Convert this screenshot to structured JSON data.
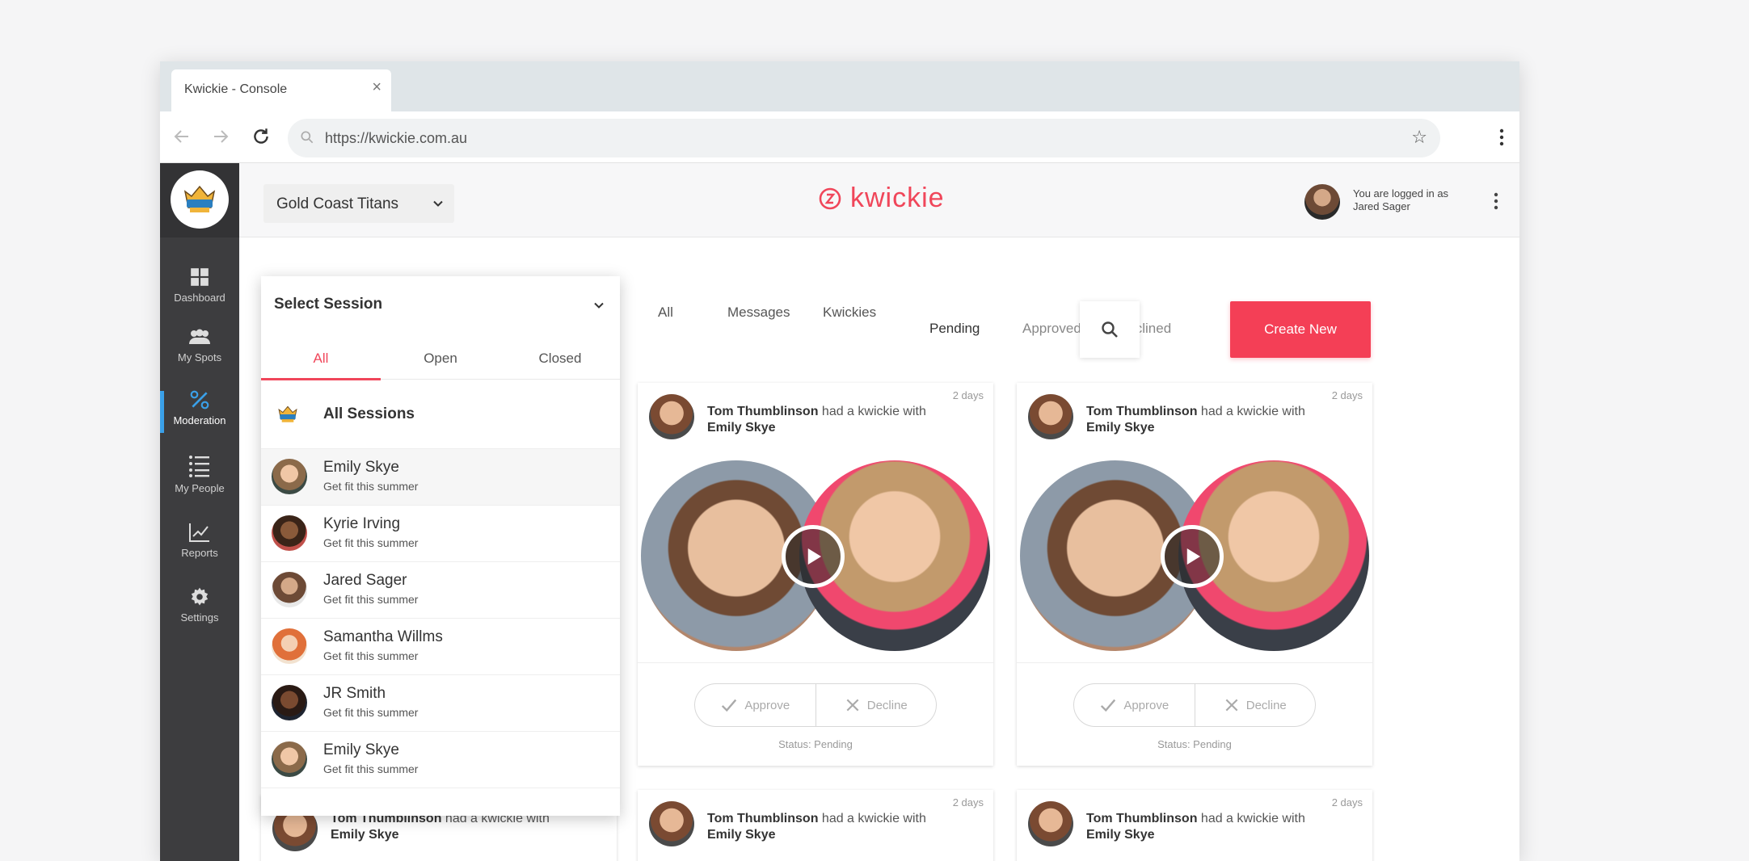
{
  "browser": {
    "tab_title": "Kwickie - Console",
    "url": "https://kwickie.com.au"
  },
  "sidebar": {
    "items": [
      {
        "label": "Dashboard",
        "icon": "grid-icon"
      },
      {
        "label": "My Spots",
        "icon": "people-icon"
      },
      {
        "label": "Moderation",
        "icon": "percent-icon",
        "active": true
      },
      {
        "label": "My People",
        "icon": "list-icon"
      },
      {
        "label": "Reports",
        "icon": "chart-icon"
      },
      {
        "label": "Settings",
        "icon": "gear-icon"
      }
    ]
  },
  "header": {
    "org_name": "Gold Coast Titans",
    "brand": "kwickie",
    "user_line1": "You are logged in as",
    "user_line2": "Jared Sager"
  },
  "filters": {
    "type_tabs": [
      "All",
      "Messages",
      "Kwickies"
    ],
    "status_tabs": [
      "Pending",
      "Approved",
      "Declined"
    ],
    "create_label": "Create New"
  },
  "session_panel": {
    "title": "Select Session",
    "tabs": [
      "All",
      "Open",
      "Closed"
    ],
    "all_label": "All Sessions",
    "sessions": [
      {
        "name": "Emily Skye",
        "sub": "Get fit this summer"
      },
      {
        "name": "Kyrie Irving",
        "sub": "Get fit this summer"
      },
      {
        "name": "Jared Sager",
        "sub": "Get fit this summer"
      },
      {
        "name": "Samantha Willms",
        "sub": "Get fit this summer"
      },
      {
        "name": "JR Smith",
        "sub": "Get fit this summer"
      },
      {
        "name": "Emily Skye",
        "sub": "Get fit this summer"
      }
    ]
  },
  "card": {
    "from": "Tom Thumblinson",
    "verb": " had a kwickie with",
    "to": "Emily Skye",
    "time": "2 days",
    "approve": "Approve",
    "decline": "Decline",
    "status": "Status: Pending"
  },
  "colors": {
    "accent": "#f43f56",
    "sidebar": "#3d3d3f",
    "active_indicator": "#3aa0e8"
  }
}
